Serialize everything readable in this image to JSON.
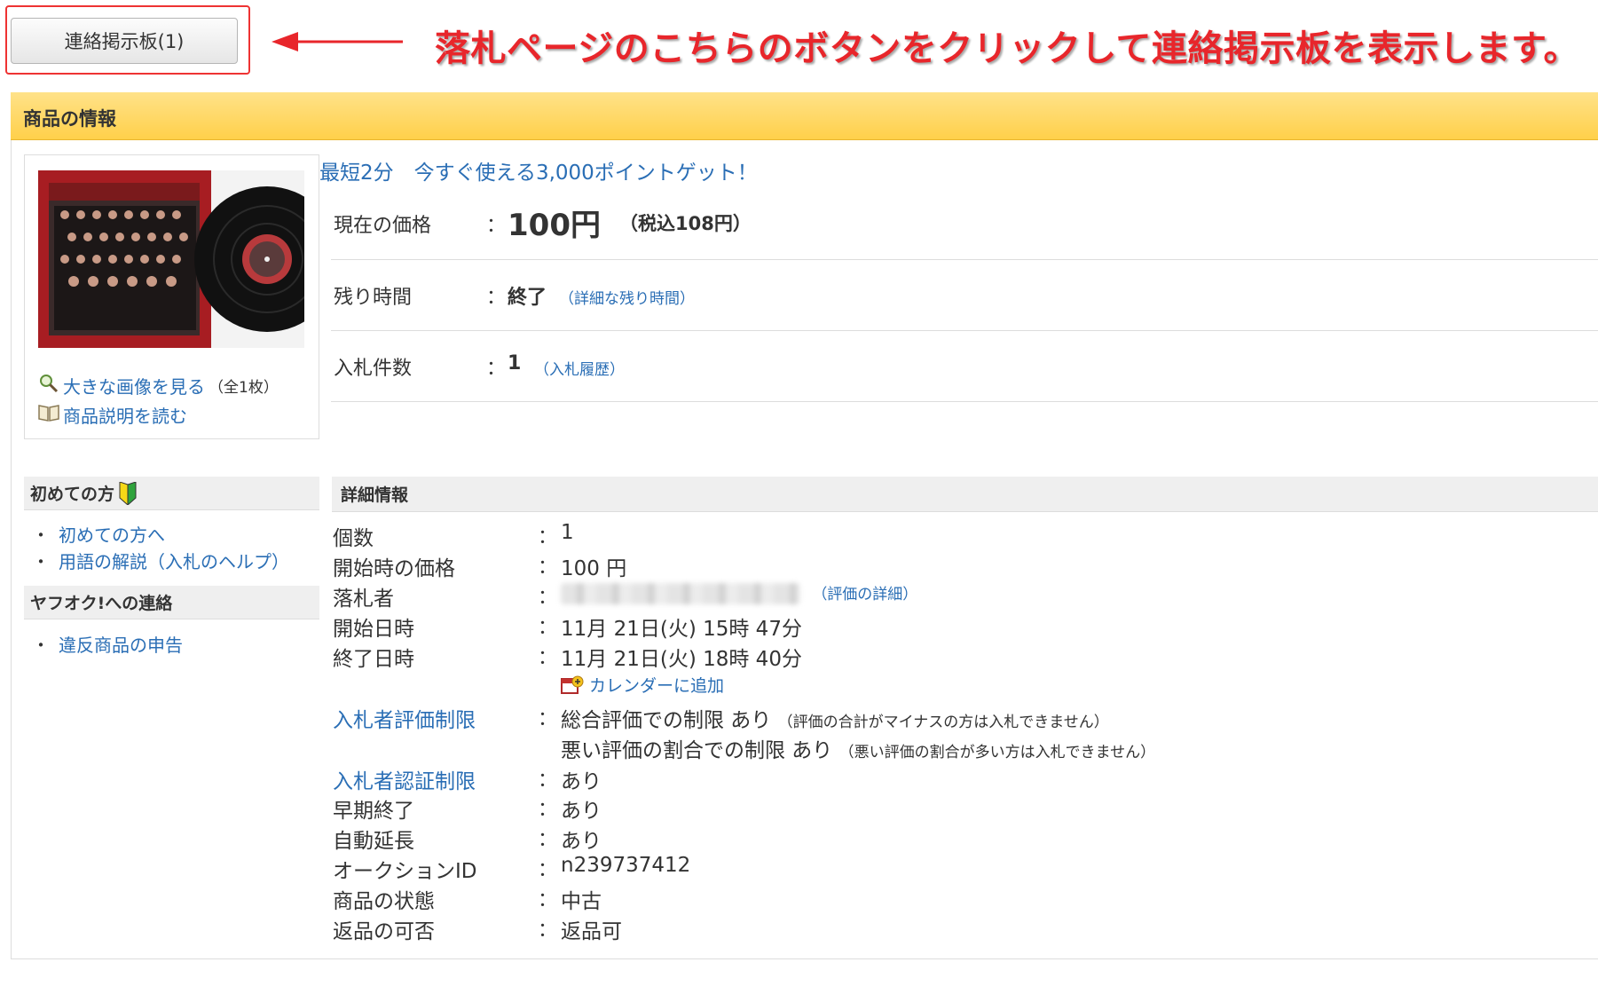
{
  "top": {
    "bbs_button": "連絡掲示板(1)",
    "callout": "落札ページのこちらのボタンをクリックして連絡掲示板を表示します。"
  },
  "section": {
    "title": "商品の情報"
  },
  "image_box": {
    "view_large": "大きな画像を見る",
    "view_large_count": "（全1枚）",
    "read_description": "商品説明を読む"
  },
  "promo": "最短2分　今すぐ使える3,000ポイントゲット！",
  "price_info": {
    "price_label": "現在の価格",
    "price": "100円",
    "price_tax": "（税込108円）",
    "time_label": "残り時間",
    "time_value": "終了",
    "time_link": "（詳細な残り時間）",
    "bids_label": "入札件数",
    "bids_value": "1",
    "bids_link": "（入札履歴）",
    "colon": "："
  },
  "sidebar": {
    "beginners_title": "初めての方",
    "beginners_items": [
      "初めての方へ",
      "用語の解説（入札のヘルプ）"
    ],
    "contact_title": "ヤフオク!への連絡",
    "contact_items": [
      "違反商品の申告"
    ],
    "bullet": "・"
  },
  "details": {
    "title": "詳細情報",
    "rows": [
      {
        "label": "個数",
        "value": "1"
      },
      {
        "label": "開始時の価格",
        "value": "100 円"
      },
      {
        "label": "落札者",
        "value": "",
        "link": "（評価の詳細）"
      },
      {
        "label": "開始日時",
        "value": "11月 21日(火) 15時 47分"
      },
      {
        "label": "終了日時",
        "value": "11月 21日(火) 18時 40分"
      },
      {
        "label": "",
        "value": "カレンダーに追加"
      },
      {
        "label": "入札者評価制限",
        "value": "総合評価での制限 あり",
        "note": "（評価の合計がマイナスの方は入札できません）"
      },
      {
        "label": "",
        "value": "悪い評価の割合での制限 あり",
        "note": "（悪い評価の割合が多い方は入札できません）"
      },
      {
        "label": "入札者認証制限",
        "value": "あり"
      },
      {
        "label": "早期終了",
        "value": "あり"
      },
      {
        "label": "自動延長",
        "value": "あり"
      },
      {
        "label": "オークションID",
        "value": "n239737412"
      },
      {
        "label": "商品の状態",
        "value": "中古"
      },
      {
        "label": "返品の可否",
        "value": "返品可"
      }
    ]
  }
}
